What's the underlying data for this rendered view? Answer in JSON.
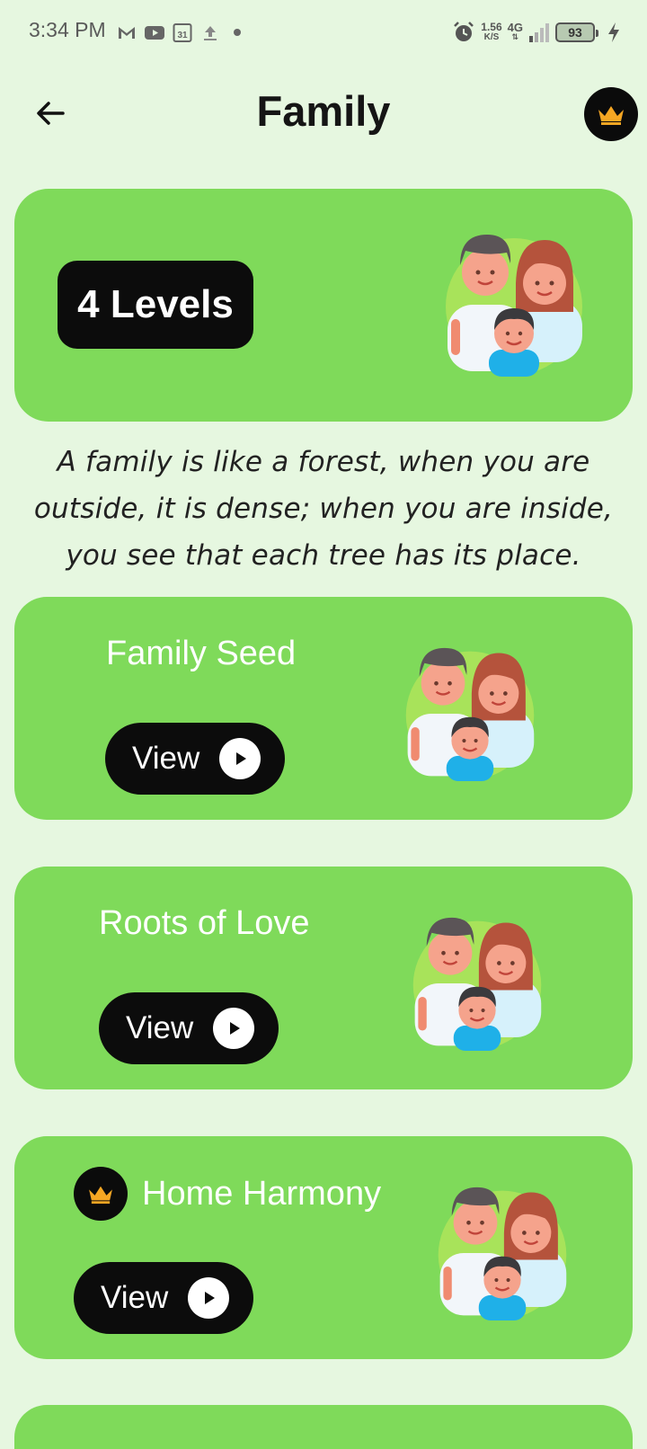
{
  "status_bar": {
    "time": "3:34 PM",
    "net_speed_value": "1.56",
    "net_speed_unit": "K/S",
    "network_type": "4G",
    "battery_level": "93"
  },
  "header": {
    "title": "Family"
  },
  "hero": {
    "levels_label": "4 Levels"
  },
  "quote": "A family is like a forest, when you are outside, it is dense; when you are inside, you see that each tree has its place.",
  "levels": [
    {
      "title": "Family Seed",
      "button_label": "View",
      "premium": false
    },
    {
      "title": "Roots of Love",
      "button_label": "View",
      "premium": false
    },
    {
      "title": "Home Harmony",
      "button_label": "View",
      "premium": true
    }
  ],
  "colors": {
    "background": "#e6f7e0",
    "card": "#7fda5a",
    "button": "#0c0c0c",
    "crown": "#f5a623"
  }
}
